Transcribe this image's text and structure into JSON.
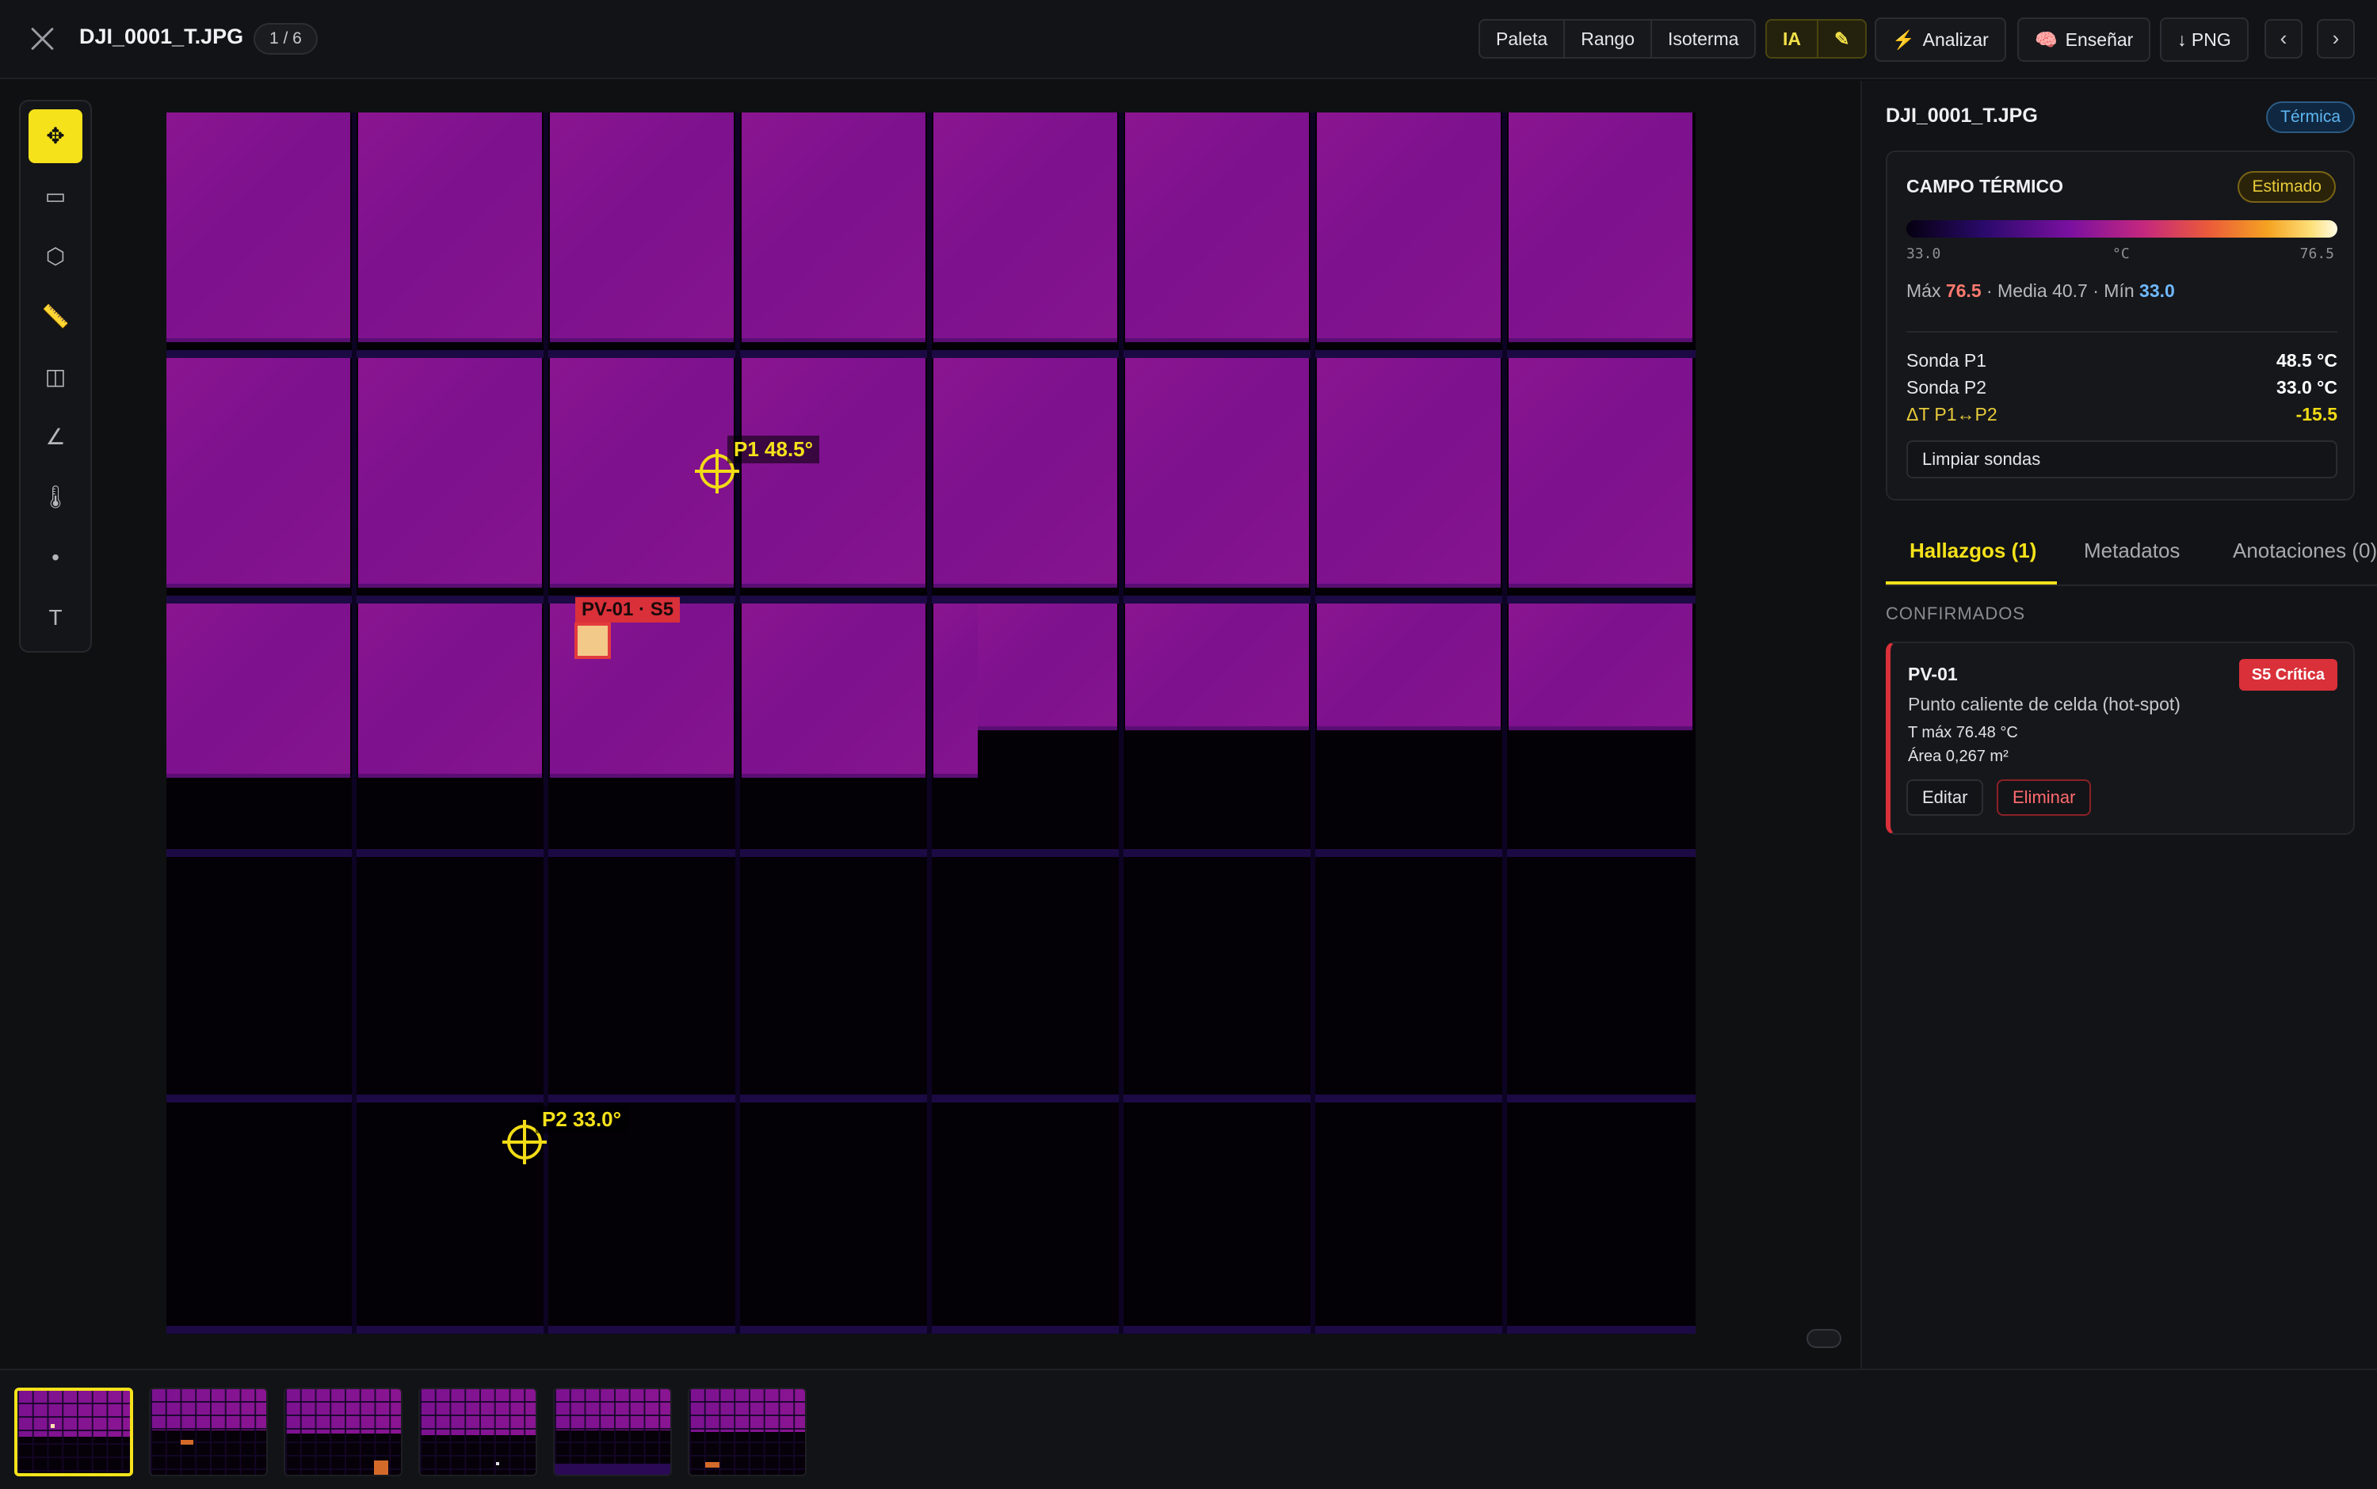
{
  "header": {
    "filename": "DJI_0001_T.JPG",
    "counter": "1 / 6",
    "view_buttons": [
      "Paleta",
      "Rango",
      "Isoterma"
    ],
    "ia_label": "IA",
    "pencil_icon": "✎",
    "analyze_label": "Analizar",
    "analyze_icon": "⚡",
    "teach_label": "Enseñar",
    "teach_icon": "🧠",
    "export_label": "↓ PNG",
    "prev_icon": "‹",
    "next_icon": "›"
  },
  "tools": [
    {
      "name": "move-icon",
      "glyph": "✥",
      "active": true
    },
    {
      "name": "rectangle-icon",
      "glyph": "▭",
      "active": false
    },
    {
      "name": "polygon-icon",
      "glyph": "⬡",
      "active": false
    },
    {
      "name": "ruler-icon",
      "glyph": "📏",
      "active": false
    },
    {
      "name": "compare-icon",
      "glyph": "◫",
      "active": false
    },
    {
      "name": "angle-icon",
      "glyph": "∠",
      "active": false
    },
    {
      "name": "thermometer-icon",
      "glyph": "🌡",
      "active": false
    },
    {
      "name": "point-icon",
      "glyph": "•",
      "active": false
    },
    {
      "name": "text-icon",
      "glyph": "T",
      "active": false
    }
  ],
  "canvas": {
    "probes": [
      {
        "id": "P1",
        "label": "P1 48.5°"
      },
      {
        "id": "P2",
        "label": "P2 33.0°"
      }
    ],
    "finding_label": "PV-01 · S5"
  },
  "sidebar": {
    "title": "DJI_0001_T.JPG",
    "mode_badge": "Térmica",
    "field": {
      "title": "CAMPO TÉRMICO",
      "badge": "Estimado",
      "scale_min": "33.0",
      "scale_unit": "°C",
      "scale_max": "76.5",
      "max_label": "Máx",
      "max_value": "76.5",
      "mean_text": " · Media 40.7 · ",
      "min_label": "Mín",
      "min_value": "33.0"
    },
    "probe_rows": [
      {
        "label": "Sonda P1",
        "value": "48.5 °C"
      },
      {
        "label": "Sonda P2",
        "value": "33.0 °C"
      },
      {
        "label": "ΔT P1↔P2",
        "value": "-15.5"
      }
    ],
    "clear_probes": "Limpiar sondas",
    "tabs": [
      "Hallazgos (1)",
      "Metadatos",
      "Anotaciones (0)"
    ],
    "section": "CONFIRMADOS",
    "finding": {
      "id": "PV-01",
      "severity": "S5 Crítica",
      "description": "Punto caliente de celda (hot-spot)",
      "tmax": "T máx 76.48 °C",
      "area": "Área 0,267 m²",
      "edit": "Editar",
      "delete": "Eliminar"
    }
  },
  "colors": {
    "accent": "#f5e21a",
    "critical": "#d9303a",
    "panel_hot": "#8a1590",
    "thermal_cold": "#040106"
  }
}
